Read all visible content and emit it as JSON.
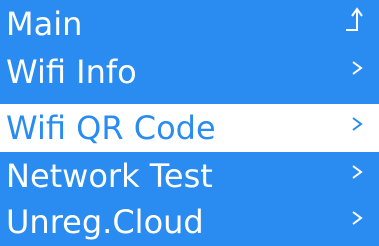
{
  "menu": {
    "items": [
      {
        "label": "Main",
        "icon": "up-arrow-icon",
        "selected": false
      },
      {
        "label": "Wifi Info",
        "icon": "chevron-right-icon",
        "selected": false
      },
      {
        "label": "Wifi QR Code",
        "icon": "chevron-right-icon",
        "selected": true
      },
      {
        "label": "Network Test",
        "icon": "chevron-right-icon",
        "selected": false
      },
      {
        "label": "Unreg.Cloud",
        "icon": "chevron-right-icon",
        "selected": false
      }
    ]
  },
  "colors": {
    "background": "#2a8cf0",
    "text": "#ffffff",
    "selected_background": "#ffffff",
    "selected_text": "#2a8cf0"
  }
}
